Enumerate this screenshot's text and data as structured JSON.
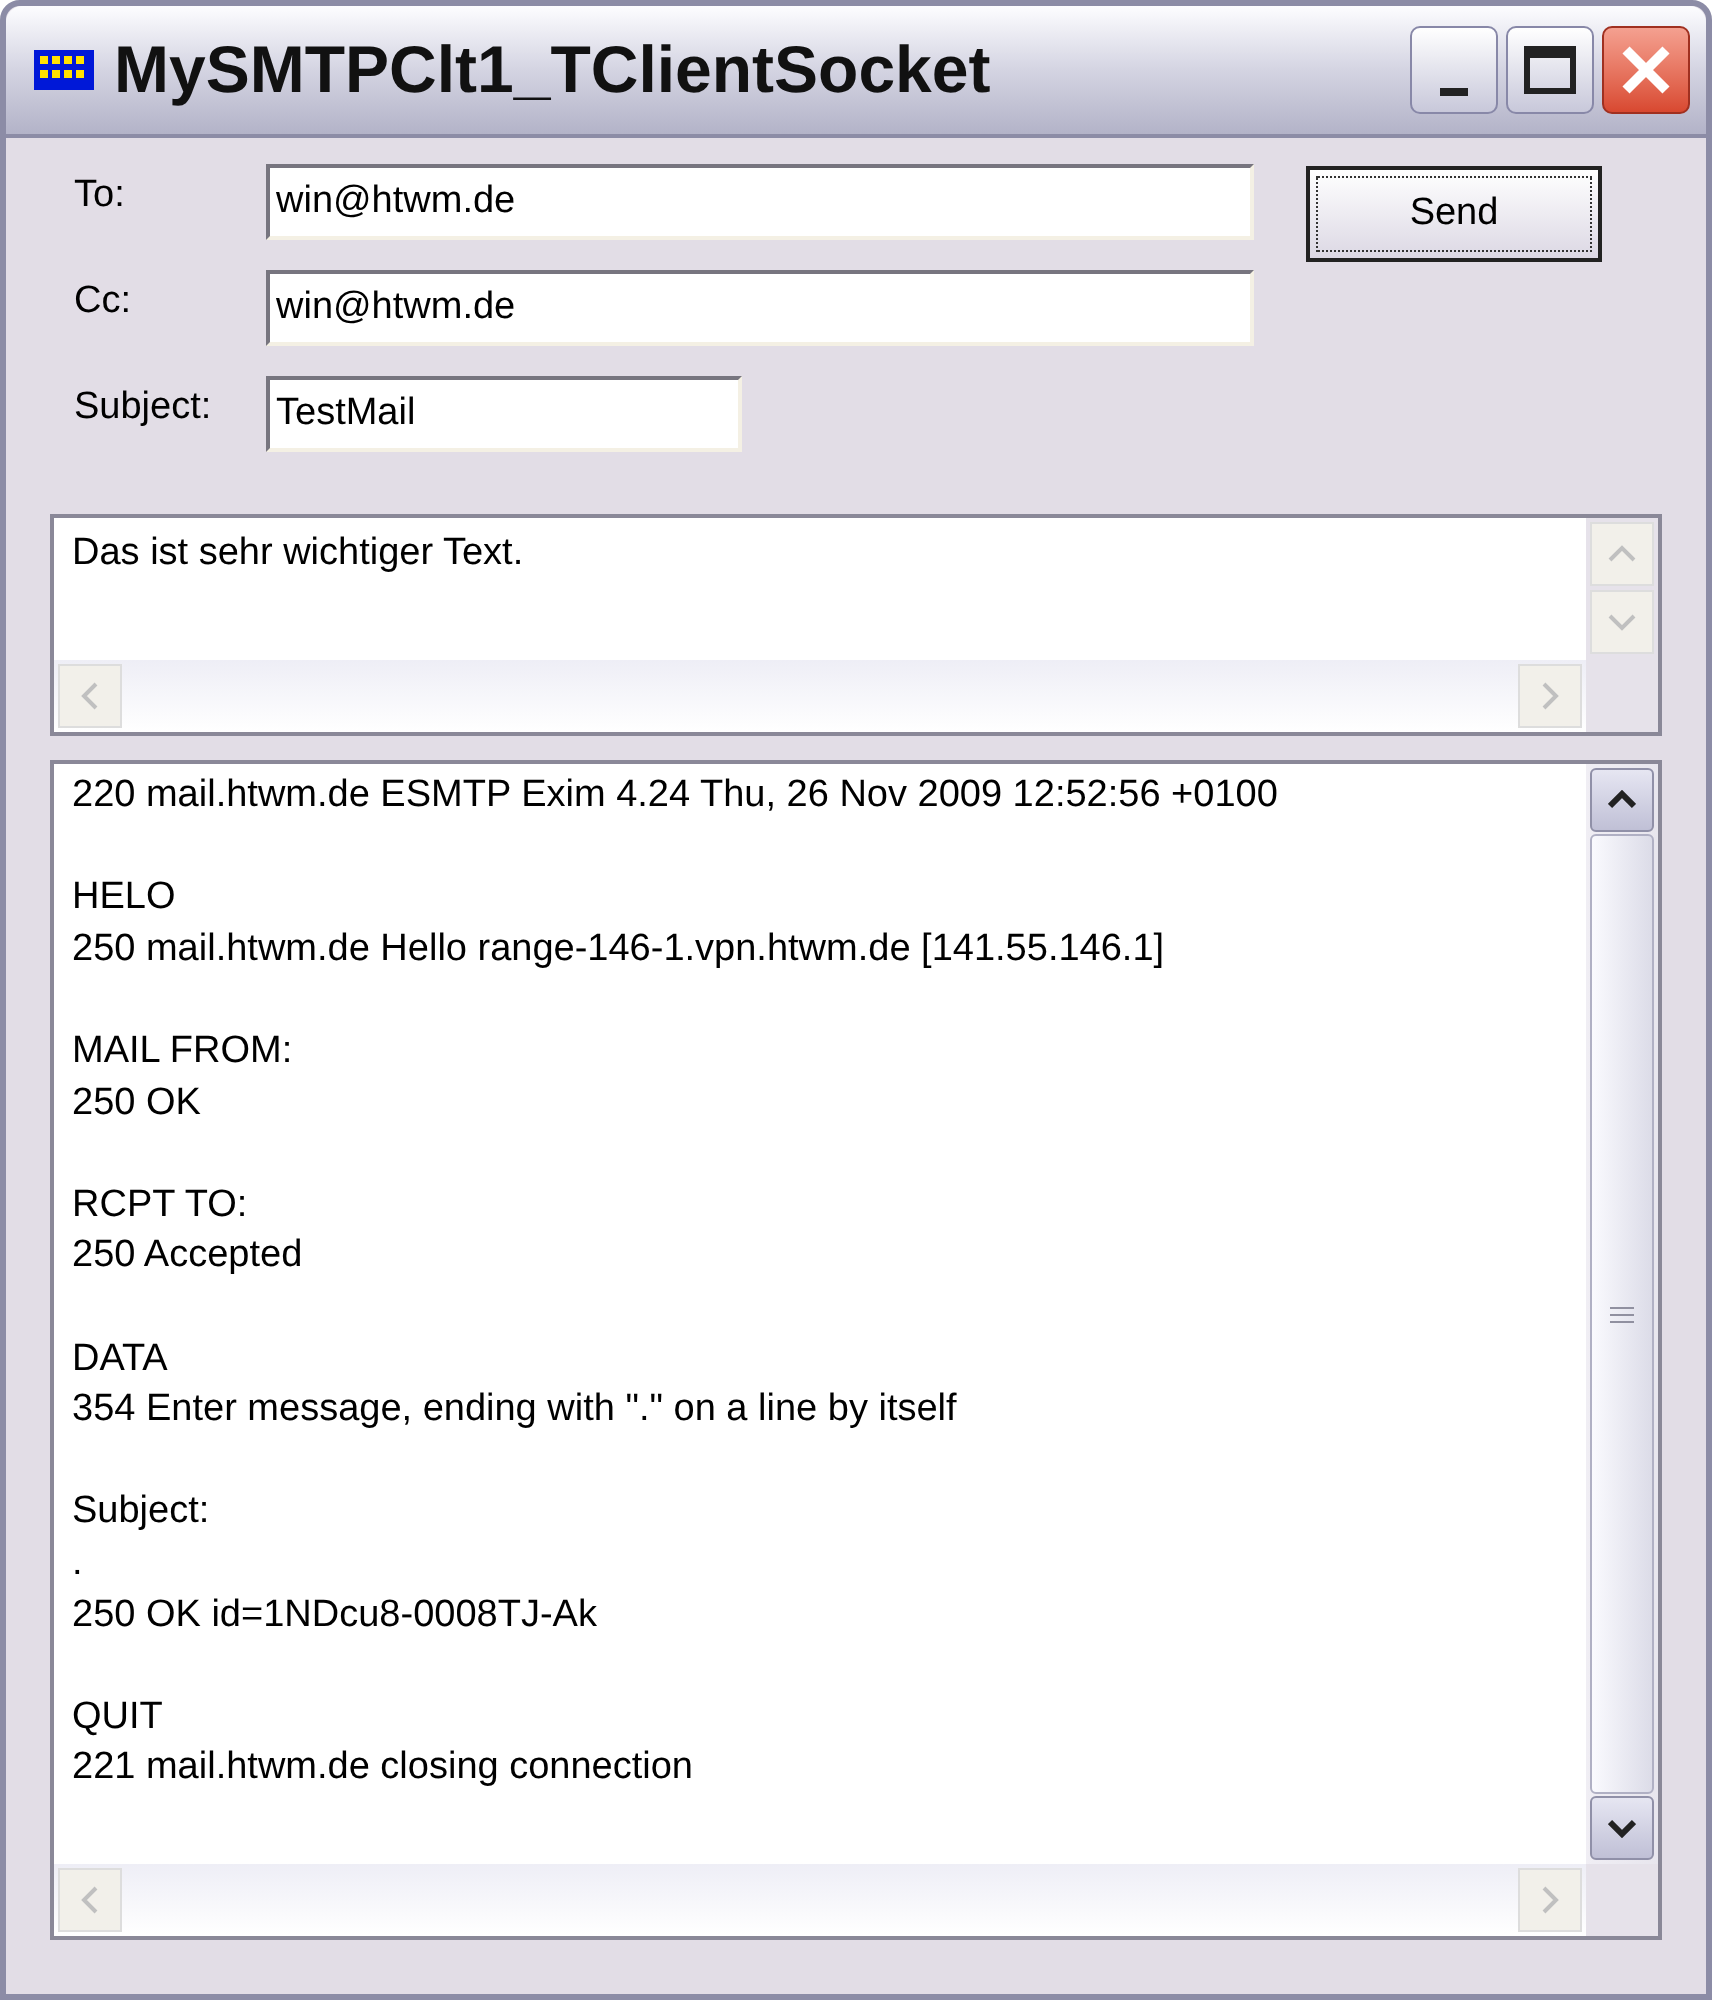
{
  "window": {
    "title": "MySMTPClt1_TClientSocket"
  },
  "fields": [
    {
      "label": "To:",
      "value": "win@htwm.de",
      "kind": "wide"
    },
    {
      "label": "Cc:",
      "value": "win@htwm.de",
      "kind": "wide"
    },
    {
      "label": "Subject:",
      "value": "TestMail",
      "kind": "short"
    }
  ],
  "send_button": {
    "label": "Send"
  },
  "message": {
    "text": "Das ist sehr wichtiger Text."
  },
  "log": [
    [
      "220 mail.htwm.de ESMTP Exim 4.24 Thu, 26 Nov 2009 12:52:56 +0100"
    ],
    [
      "HELO",
      "250 mail.htwm.de Hello range-146-1.vpn.htwm.de [141.55.146.1]"
    ],
    [
      "MAIL FROM:",
      "250 OK"
    ],
    [
      "RCPT TO:",
      "250 Accepted"
    ],
    [
      "DATA",
      "354 Enter message, ending with \".\" on a line by itself"
    ],
    [
      "Subject:",
      ".",
      "250 OK id=1NDcu8-0008TJ-Ak"
    ],
    [
      "QUIT",
      "221 mail.htwm.de closing connection"
    ]
  ]
}
